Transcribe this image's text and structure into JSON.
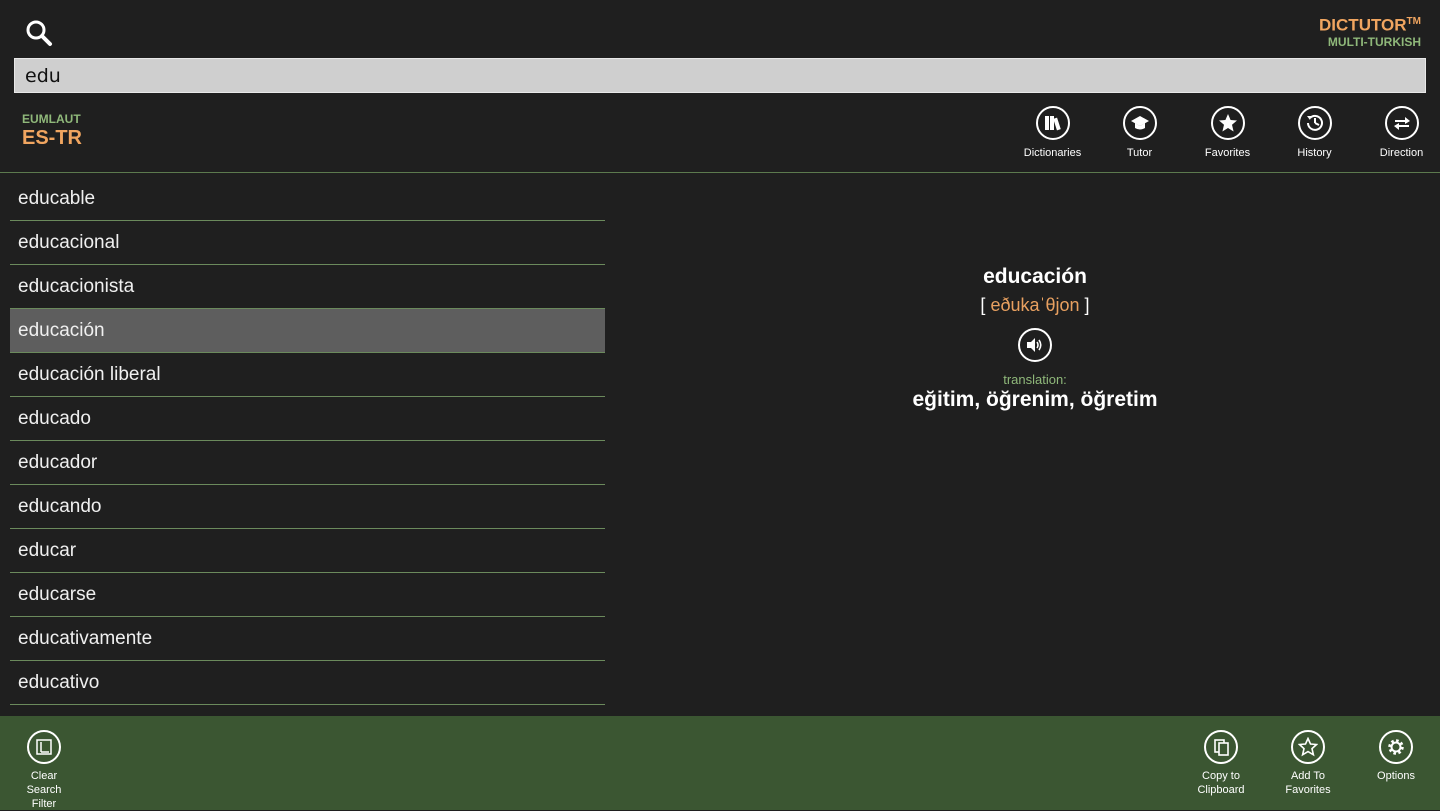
{
  "app": {
    "brand": "DICTUTOR",
    "brand_tm": "TM",
    "subtitle": "MULTI-TURKISH"
  },
  "search": {
    "value": "edu"
  },
  "dictionary": {
    "vendor": "EUMLAUT",
    "pair": "ES-TR"
  },
  "toolbar": [
    {
      "label": "Dictionaries",
      "icon": "books-icon"
    },
    {
      "label": "Tutor",
      "icon": "graduation-cap-icon"
    },
    {
      "label": "Favorites",
      "icon": "star-icon"
    },
    {
      "label": "History",
      "icon": "history-clock-icon"
    },
    {
      "label": "Direction",
      "icon": "swap-arrows-icon"
    }
  ],
  "words": [
    "educable",
    "educacional",
    "educacionista",
    "educación",
    "educación liberal",
    "educado",
    "educador",
    "educando",
    "educar",
    "educarse",
    "educativamente",
    "educativo"
  ],
  "selected_index": 3,
  "entry": {
    "headword": "educación",
    "pron_open": "[",
    "pronunciation": "eðukaˈθjon",
    "pron_close": "]",
    "translation_label": "translation:",
    "translation": "eğitim, öğrenim, öğretim"
  },
  "appbar": {
    "clear": "Clear Search Filter",
    "copy": "Copy to Clipboard",
    "add_fav": "Add To Favorites",
    "options": "Options"
  },
  "colors": {
    "accent_orange": "#f0a560",
    "accent_green": "#8fb87a",
    "appbar_bg": "#3b5632",
    "selected_bg": "#5e5e5e"
  }
}
